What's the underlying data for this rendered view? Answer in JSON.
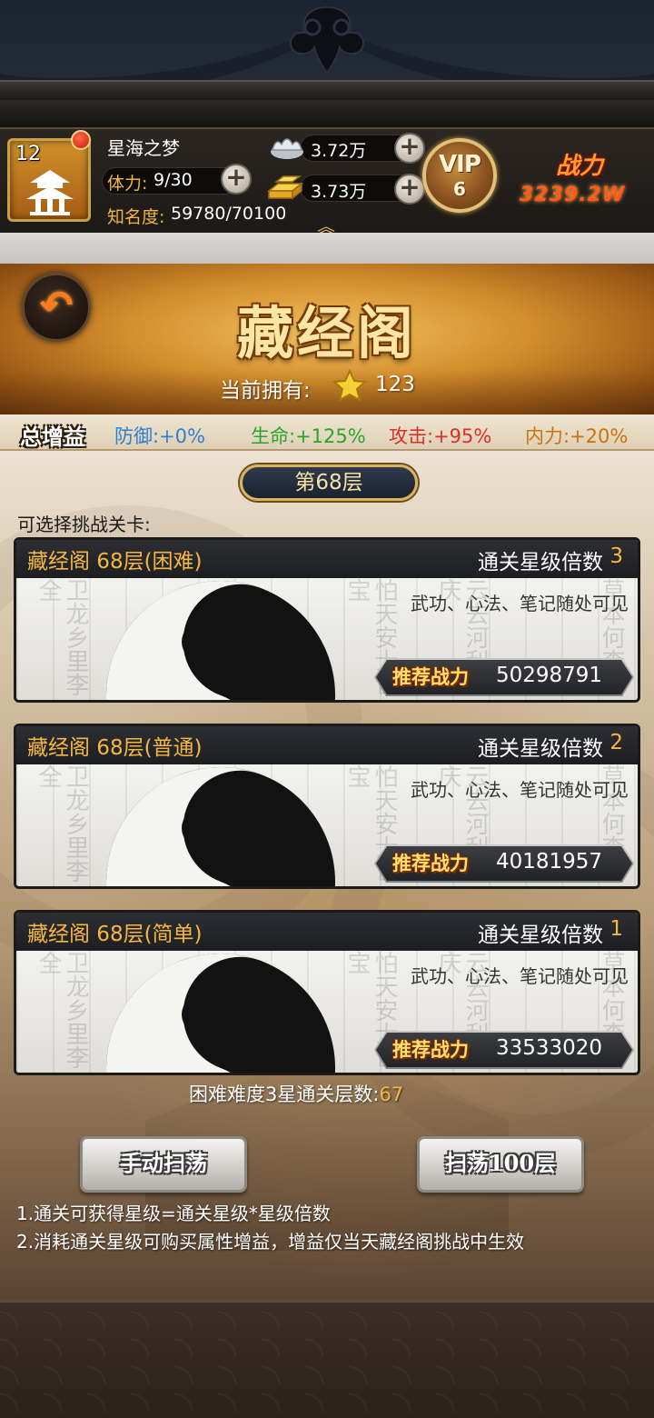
{
  "player": {
    "level": "12",
    "name": "星海之梦",
    "stamina_label": "体力:",
    "stamina_value": "9/30",
    "fame_label": "知名度:",
    "fame_value": "59780/70100",
    "silver": "3.72万",
    "gold": "3.73万",
    "vip_label": "VIP",
    "vip_level": "6",
    "power_label": "战力",
    "power_value": "3239.2W"
  },
  "page": {
    "title": "藏经阁",
    "own_label": "当前拥有:",
    "own_value": "123"
  },
  "bonus": {
    "title": "总增益",
    "defense": "防御:+0%",
    "life": "生命:+125%",
    "attack": "攻击:+95%",
    "inner": "内力:+20%",
    "colors": {
      "defense": "#2f7fd6",
      "life": "#2aa52a",
      "attack": "#d9302a",
      "inner": "#c8740f"
    }
  },
  "floor_badge": "第68层",
  "select_label": "可选择挑战关卡:",
  "stages": [
    {
      "name": "藏经阁 68层(困难)",
      "mult_label": "通关星级倍数",
      "mult": "3",
      "desc": "武功、心法、笔记随处可见",
      "rec_label": "推荐战力",
      "rec_value": "50298791"
    },
    {
      "name": "藏经阁 68层(普通)",
      "mult_label": "通关星级倍数",
      "mult": "2",
      "desc": "武功、心法、笔记随处可见",
      "rec_label": "推荐战力",
      "rec_value": "40181957"
    },
    {
      "name": "藏经阁 68层(简单)",
      "mult_label": "通关星级倍数",
      "mult": "1",
      "desc": "武功、心法、笔记随处可见",
      "rec_label": "推荐战力",
      "rec_value": "33533020"
    }
  ],
  "cleared_label": "困难难度3星通关层数:",
  "cleared_value": "67",
  "buttons": {
    "manual": "手动扫荡",
    "sweep": "扫荡100层"
  },
  "notes": [
    "1.通关可获得星级=通关星级*星级倍数",
    "2.消耗通关星级可购买属性增益，增益仅当天藏经阁挑战中生效"
  ]
}
